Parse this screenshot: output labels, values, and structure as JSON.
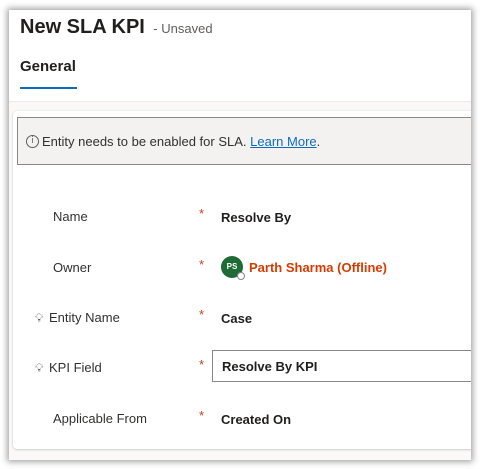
{
  "form": {
    "title": "New SLA KPI",
    "status": "- Unsaved"
  },
  "tabs": [
    {
      "label": "General",
      "active": true
    }
  ],
  "notice": {
    "icon": "info-icon",
    "text": "Entity needs to be enabled for SLA.",
    "link": "Learn More",
    "trailing": "."
  },
  "fields": {
    "name": {
      "label": "Name",
      "required": "*",
      "value": "Resolve By"
    },
    "owner": {
      "label": "Owner",
      "required": "*",
      "initials": "PS",
      "value": "Parth Sharma (Offline)"
    },
    "entity_name": {
      "label": "Entity Name",
      "required": "*",
      "value": "Case"
    },
    "kpi_field": {
      "label": "KPI Field",
      "required": "*",
      "value": "Resolve By KPI"
    },
    "applicable_from": {
      "label": "Applicable From",
      "required": "*",
      "value": "Created On"
    }
  },
  "colors": {
    "accent": "#0f6cbd",
    "required": "#c43e1c",
    "owner_link": "#d83b01",
    "avatar": "#1e6b36"
  }
}
